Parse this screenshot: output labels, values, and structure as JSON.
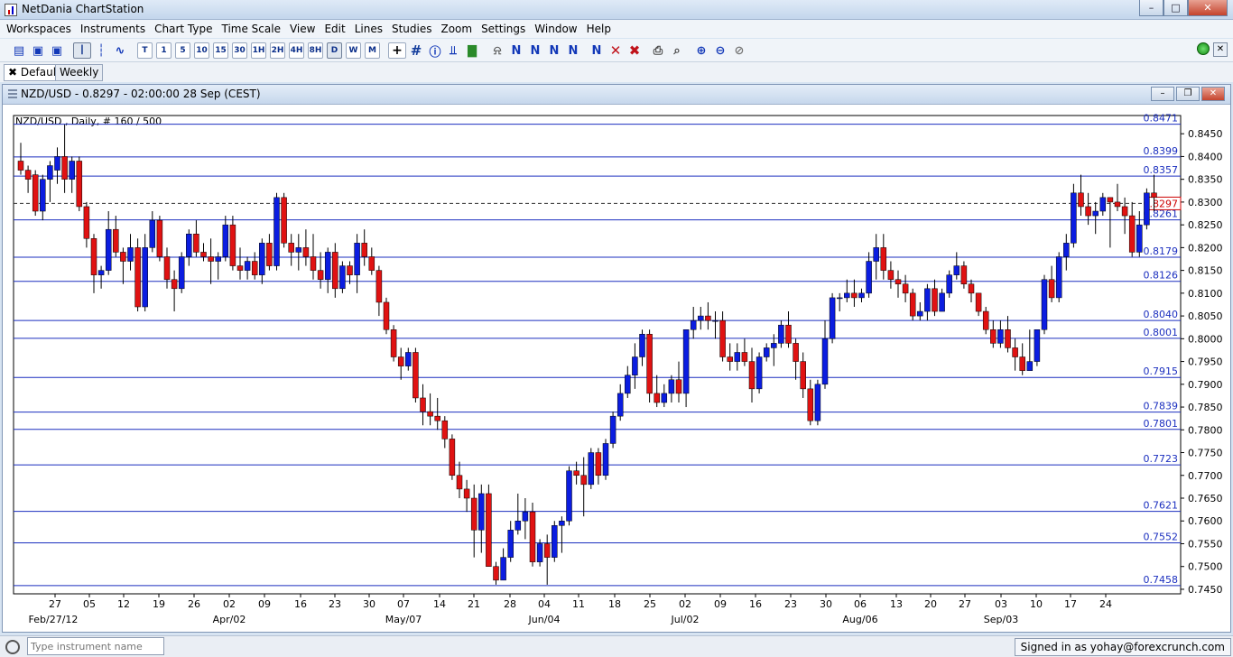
{
  "window": {
    "title": "NetDania ChartStation"
  },
  "menu": [
    "Workspaces",
    "Instruments",
    "Chart Type",
    "Time Scale",
    "View",
    "Edit",
    "Lines",
    "Studies",
    "Zoom",
    "Settings",
    "Window",
    "Help"
  ],
  "toolbar": {
    "timeframes": [
      "T",
      "1",
      "5",
      "10",
      "15",
      "30",
      "1H",
      "2H",
      "4H",
      "8H",
      "D",
      "W",
      "M"
    ],
    "selected_timeframe": "D"
  },
  "tabs": [
    {
      "label": "Default"
    },
    {
      "label": "Weekly"
    }
  ],
  "chart_window": {
    "title": "NZD/USD - 0.8297 - 02:00:00  28 Sep (CEST)"
  },
  "chart_data": {
    "type": "candlestick",
    "subtitle": "NZD/USD , Daily, # 160 / 500",
    "ylim": [
      0.744,
      0.849
    ],
    "y_ticks": [
      "0.8450",
      "0.8400",
      "0.8350",
      "0.8300",
      "0.8250",
      "0.8200",
      "0.8150",
      "0.8100",
      "0.8050",
      "0.8000",
      "0.7950",
      "0.7900",
      "0.7850",
      "0.7800",
      "0.7750",
      "0.7700",
      "0.7650",
      "0.7600",
      "0.7550",
      "0.7500",
      "0.7450"
    ],
    "x_ticks": [
      "27",
      "05",
      "12",
      "19",
      "26",
      "02",
      "09",
      "16",
      "23",
      "30",
      "07",
      "14",
      "21",
      "28",
      "04",
      "11",
      "18",
      "25",
      "02",
      "09",
      "16",
      "23",
      "30",
      "06",
      "13",
      "20",
      "27",
      "03",
      "10",
      "17",
      "24"
    ],
    "x_month_labels": [
      "Feb/27/12",
      "Apr/02",
      "May/07",
      "Jun/04",
      "Jul/02",
      "Aug/06",
      "Sep/03"
    ],
    "levels": [
      "0.8471",
      "0.8399",
      "0.8357",
      "0.8261",
      "0.8179",
      "0.8126",
      "0.8040",
      "0.8001",
      "0.7915",
      "0.7839",
      "0.7801",
      "0.7723",
      "0.7621",
      "0.7552",
      "0.7458"
    ],
    "current_price": "0.8297",
    "ohlc": [
      [
        0.839,
        0.843,
        0.836,
        0.837
      ],
      [
        0.837,
        0.838,
        0.832,
        0.835
      ],
      [
        0.836,
        0.837,
        0.827,
        0.828
      ],
      [
        0.828,
        0.836,
        0.826,
        0.835
      ],
      [
        0.835,
        0.839,
        0.83,
        0.838
      ],
      [
        0.837,
        0.842,
        0.834,
        0.84
      ],
      [
        0.84,
        0.847,
        0.832,
        0.835
      ],
      [
        0.835,
        0.84,
        0.832,
        0.839
      ],
      [
        0.839,
        0.84,
        0.828,
        0.829
      ],
      [
        0.829,
        0.83,
        0.82,
        0.822
      ],
      [
        0.822,
        0.823,
        0.81,
        0.814
      ],
      [
        0.814,
        0.816,
        0.811,
        0.815
      ],
      [
        0.815,
        0.828,
        0.814,
        0.824
      ],
      [
        0.824,
        0.827,
        0.818,
        0.819
      ],
      [
        0.819,
        0.82,
        0.812,
        0.817
      ],
      [
        0.817,
        0.823,
        0.815,
        0.82
      ],
      [
        0.82,
        0.822,
        0.806,
        0.807
      ],
      [
        0.807,
        0.823,
        0.806,
        0.82
      ],
      [
        0.82,
        0.828,
        0.819,
        0.826
      ],
      [
        0.826,
        0.827,
        0.817,
        0.818
      ],
      [
        0.818,
        0.82,
        0.811,
        0.813
      ],
      [
        0.813,
        0.815,
        0.806,
        0.811
      ],
      [
        0.811,
        0.819,
        0.81,
        0.818
      ],
      [
        0.818,
        0.824,
        0.816,
        0.823
      ],
      [
        0.823,
        0.826,
        0.818,
        0.819
      ],
      [
        0.819,
        0.821,
        0.817,
        0.818
      ],
      [
        0.818,
        0.822,
        0.812,
        0.817
      ],
      [
        0.817,
        0.819,
        0.813,
        0.818
      ],
      [
        0.818,
        0.827,
        0.817,
        0.825
      ],
      [
        0.825,
        0.827,
        0.815,
        0.816
      ],
      [
        0.816,
        0.82,
        0.813,
        0.815
      ],
      [
        0.815,
        0.818,
        0.813,
        0.817
      ],
      [
        0.817,
        0.819,
        0.813,
        0.814
      ],
      [
        0.814,
        0.822,
        0.812,
        0.821
      ],
      [
        0.821,
        0.823,
        0.815,
        0.816
      ],
      [
        0.816,
        0.832,
        0.815,
        0.831
      ],
      [
        0.831,
        0.832,
        0.82,
        0.821
      ],
      [
        0.821,
        0.823,
        0.816,
        0.819
      ],
      [
        0.819,
        0.823,
        0.815,
        0.82
      ],
      [
        0.82,
        0.824,
        0.816,
        0.818
      ],
      [
        0.818,
        0.823,
        0.813,
        0.815
      ],
      [
        0.815,
        0.819,
        0.811,
        0.813
      ],
      [
        0.813,
        0.82,
        0.81,
        0.819
      ],
      [
        0.819,
        0.821,
        0.809,
        0.811
      ],
      [
        0.811,
        0.817,
        0.81,
        0.816
      ],
      [
        0.816,
        0.817,
        0.812,
        0.814
      ],
      [
        0.814,
        0.823,
        0.81,
        0.821
      ],
      [
        0.821,
        0.824,
        0.816,
        0.818
      ],
      [
        0.818,
        0.82,
        0.814,
        0.815
      ],
      [
        0.815,
        0.816,
        0.805,
        0.808
      ],
      [
        0.808,
        0.809,
        0.801,
        0.802
      ],
      [
        0.802,
        0.803,
        0.795,
        0.796
      ],
      [
        0.796,
        0.798,
        0.791,
        0.794
      ],
      [
        0.794,
        0.798,
        0.793,
        0.797
      ],
      [
        0.797,
        0.798,
        0.786,
        0.787
      ],
      [
        0.787,
        0.79,
        0.781,
        0.784
      ],
      [
        0.784,
        0.788,
        0.781,
        0.783
      ],
      [
        0.783,
        0.787,
        0.78,
        0.782
      ],
      [
        0.782,
        0.783,
        0.776,
        0.778
      ],
      [
        0.778,
        0.779,
        0.769,
        0.77
      ],
      [
        0.77,
        0.773,
        0.765,
        0.767
      ],
      [
        0.767,
        0.769,
        0.762,
        0.765
      ],
      [
        0.765,
        0.768,
        0.752,
        0.758
      ],
      [
        0.758,
        0.768,
        0.753,
        0.766
      ],
      [
        0.766,
        0.768,
        0.75,
        0.75
      ],
      [
        0.75,
        0.751,
        0.746,
        0.747
      ],
      [
        0.747,
        0.754,
        0.747,
        0.752
      ],
      [
        0.752,
        0.76,
        0.751,
        0.758
      ],
      [
        0.758,
        0.766,
        0.757,
        0.76
      ],
      [
        0.76,
        0.765,
        0.756,
        0.762
      ],
      [
        0.762,
        0.764,
        0.75,
        0.751
      ],
      [
        0.751,
        0.756,
        0.75,
        0.755
      ],
      [
        0.755,
        0.757,
        0.746,
        0.752
      ],
      [
        0.752,
        0.76,
        0.751,
        0.759
      ],
      [
        0.759,
        0.761,
        0.753,
        0.76
      ],
      [
        0.76,
        0.772,
        0.759,
        0.771
      ],
      [
        0.771,
        0.773,
        0.768,
        0.77
      ],
      [
        0.77,
        0.774,
        0.761,
        0.768
      ],
      [
        0.768,
        0.776,
        0.767,
        0.775
      ],
      [
        0.775,
        0.776,
        0.768,
        0.77
      ],
      [
        0.77,
        0.778,
        0.769,
        0.777
      ],
      [
        0.777,
        0.784,
        0.776,
        0.783
      ],
      [
        0.783,
        0.79,
        0.782,
        0.788
      ],
      [
        0.788,
        0.794,
        0.787,
        0.792
      ],
      [
        0.792,
        0.799,
        0.789,
        0.796
      ],
      [
        0.796,
        0.802,
        0.794,
        0.801
      ],
      [
        0.801,
        0.802,
        0.786,
        0.788
      ],
      [
        0.788,
        0.792,
        0.785,
        0.786
      ],
      [
        0.786,
        0.79,
        0.785,
        0.788
      ],
      [
        0.788,
        0.792,
        0.786,
        0.791
      ],
      [
        0.791,
        0.795,
        0.786,
        0.788
      ],
      [
        0.788,
        0.798,
        0.785,
        0.802
      ],
      [
        0.802,
        0.807,
        0.8,
        0.804
      ],
      [
        0.804,
        0.807,
        0.802,
        0.805
      ],
      [
        0.805,
        0.808,
        0.802,
        0.804
      ],
      [
        0.804,
        0.806,
        0.8,
        0.804
      ],
      [
        0.804,
        0.806,
        0.795,
        0.796
      ],
      [
        0.796,
        0.799,
        0.793,
        0.795
      ],
      [
        0.795,
        0.799,
        0.793,
        0.797
      ],
      [
        0.797,
        0.8,
        0.794,
        0.795
      ],
      [
        0.795,
        0.798,
        0.786,
        0.789
      ],
      [
        0.789,
        0.797,
        0.788,
        0.796
      ],
      [
        0.796,
        0.799,
        0.795,
        0.798
      ],
      [
        0.798,
        0.801,
        0.794,
        0.799
      ],
      [
        0.799,
        0.804,
        0.798,
        0.803
      ],
      [
        0.803,
        0.806,
        0.798,
        0.799
      ],
      [
        0.799,
        0.8,
        0.791,
        0.795
      ],
      [
        0.795,
        0.797,
        0.787,
        0.789
      ],
      [
        0.789,
        0.791,
        0.781,
        0.782
      ],
      [
        0.782,
        0.791,
        0.781,
        0.79
      ],
      [
        0.79,
        0.804,
        0.789,
        0.8
      ],
      [
        0.8,
        0.81,
        0.799,
        0.809
      ],
      [
        0.809,
        0.81,
        0.806,
        0.809
      ],
      [
        0.809,
        0.813,
        0.808,
        0.81
      ],
      [
        0.81,
        0.813,
        0.807,
        0.809
      ],
      [
        0.809,
        0.811,
        0.808,
        0.81
      ],
      [
        0.81,
        0.819,
        0.809,
        0.817
      ],
      [
        0.817,
        0.823,
        0.813,
        0.82
      ],
      [
        0.82,
        0.823,
        0.813,
        0.815
      ],
      [
        0.815,
        0.817,
        0.811,
        0.813
      ],
      [
        0.813,
        0.815,
        0.809,
        0.812
      ],
      [
        0.812,
        0.814,
        0.808,
        0.81
      ],
      [
        0.81,
        0.811,
        0.804,
        0.805
      ],
      [
        0.805,
        0.808,
        0.804,
        0.806
      ],
      [
        0.806,
        0.812,
        0.804,
        0.811
      ],
      [
        0.811,
        0.813,
        0.805,
        0.806
      ],
      [
        0.806,
        0.811,
        0.806,
        0.81
      ],
      [
        0.81,
        0.815,
        0.809,
        0.814
      ],
      [
        0.814,
        0.819,
        0.813,
        0.816
      ],
      [
        0.816,
        0.817,
        0.811,
        0.812
      ],
      [
        0.812,
        0.813,
        0.808,
        0.81
      ],
      [
        0.81,
        0.81,
        0.805,
        0.806
      ],
      [
        0.806,
        0.807,
        0.801,
        0.802
      ],
      [
        0.802,
        0.804,
        0.798,
        0.799
      ],
      [
        0.799,
        0.804,
        0.798,
        0.802
      ],
      [
        0.802,
        0.805,
        0.797,
        0.798
      ],
      [
        0.798,
        0.8,
        0.793,
        0.796
      ],
      [
        0.796,
        0.799,
        0.792,
        0.793
      ],
      [
        0.793,
        0.802,
        0.793,
        0.795
      ],
      [
        0.795,
        0.801,
        0.794,
        0.802
      ],
      [
        0.802,
        0.814,
        0.801,
        0.813
      ],
      [
        0.813,
        0.816,
        0.808,
        0.809
      ],
      [
        0.809,
        0.819,
        0.808,
        0.818
      ],
      [
        0.818,
        0.823,
        0.815,
        0.821
      ],
      [
        0.821,
        0.834,
        0.82,
        0.832
      ],
      [
        0.832,
        0.836,
        0.827,
        0.829
      ],
      [
        0.829,
        0.832,
        0.825,
        0.827
      ],
      [
        0.827,
        0.83,
        0.823,
        0.828
      ],
      [
        0.828,
        0.832,
        0.827,
        0.831
      ],
      [
        0.831,
        0.831,
        0.82,
        0.83
      ],
      [
        0.83,
        0.834,
        0.828,
        0.829
      ],
      [
        0.829,
        0.831,
        0.823,
        0.827
      ],
      [
        0.827,
        0.83,
        0.818,
        0.819
      ],
      [
        0.819,
        0.828,
        0.818,
        0.825
      ],
      [
        0.825,
        0.833,
        0.824,
        0.832
      ],
      [
        0.832,
        0.836,
        0.828,
        0.831
      ]
    ]
  },
  "status": {
    "search_placeholder": "Type instrument name",
    "signed_in": "Signed in as yohay@forexcrunch.com"
  }
}
